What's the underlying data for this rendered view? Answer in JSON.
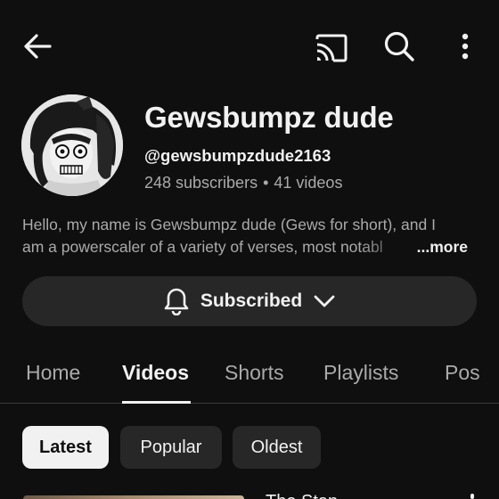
{
  "channel": {
    "name": "Gewsbumpz dude",
    "handle": "@gewsbumpzdude2163",
    "subscribers": "248 subscribers",
    "separator": "•",
    "videos": "41 videos"
  },
  "description": {
    "line1": "Hello, my name is Gewsbumpz dude (Gews for short), and I",
    "line2": "am a powerscaler of a variety of verses, most notabl",
    "more_label": "...more"
  },
  "subscribe_button": {
    "label": "Subscribed"
  },
  "tabs": [
    {
      "label": "Home",
      "active": false
    },
    {
      "label": "Videos",
      "active": true
    },
    {
      "label": "Shorts",
      "active": false
    },
    {
      "label": "Playlists",
      "active": false
    },
    {
      "label": "Pos",
      "active": false
    }
  ],
  "filters": [
    {
      "label": "Latest",
      "active": true
    },
    {
      "label": "Popular",
      "active": false
    },
    {
      "label": "Oldest",
      "active": false
    }
  ],
  "first_video": {
    "title_peek": "The Stan..."
  },
  "icons": {
    "back": "arrow-left-icon",
    "cast": "cast-icon",
    "search": "search-icon",
    "more": "more-vertical-icon",
    "bell": "bell-icon",
    "chevron": "chevron-down-icon"
  },
  "colors": {
    "background": "#0f0f0f",
    "text_primary": "#f1f1f1",
    "text_secondary": "#aaaaaa",
    "surface": "#272727"
  }
}
